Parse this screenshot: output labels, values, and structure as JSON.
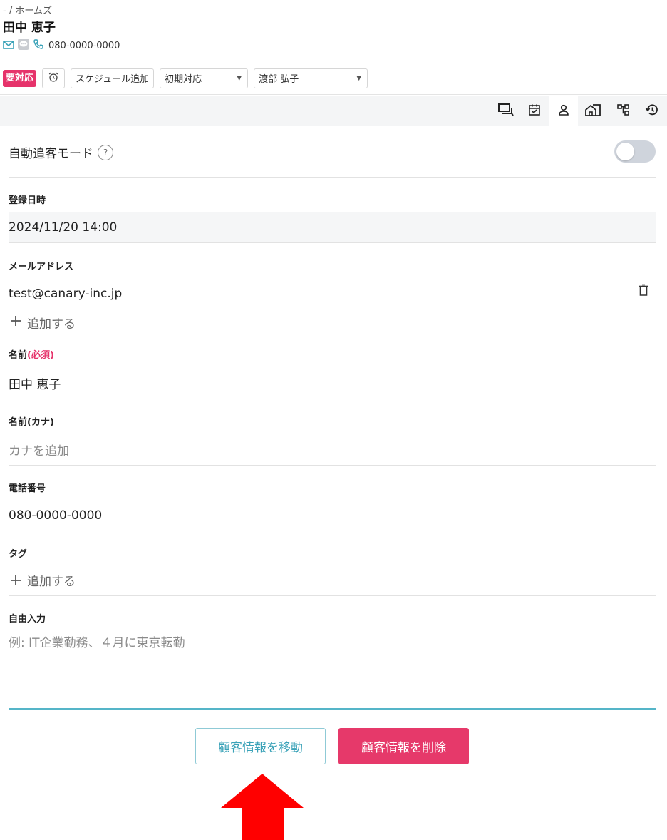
{
  "header": {
    "breadcrumb": "- / ホームズ",
    "name": "田中 恵子",
    "phone": "080-0000-0000"
  },
  "toolbar": {
    "status_badge": "要対応",
    "schedule_label": "スケジュール追加",
    "status_select": "初期対応",
    "staff_select": "渡部 弘子"
  },
  "form": {
    "auto_mode_label": "自動追客モード",
    "help_mark": "?",
    "registered_label": "登録日時",
    "registered_value": "2024/11/20 14:00",
    "email_label": "メールアドレス",
    "email_value": "test@canary-inc.jp",
    "add_label": "追加する",
    "name_label": "名前",
    "required_label": "(必須)",
    "name_value": "田中 恵子",
    "kana_label": "名前(カナ)",
    "kana_placeholder": "カナを追加",
    "phone_label": "電話番号",
    "phone_value": "080-0000-0000",
    "tag_label": "タグ",
    "tag_add_label": "追加する",
    "memo_label": "自由入力",
    "memo_placeholder": "例: IT企業勤務、４月に東京転勤"
  },
  "actions": {
    "move_label": "顧客情報を移動",
    "delete_label": "顧客情報を削除"
  },
  "colors": {
    "accent_pink": "#e6336b",
    "accent_teal": "#3aa2b8",
    "annotation_arrow": "#ff0000"
  }
}
